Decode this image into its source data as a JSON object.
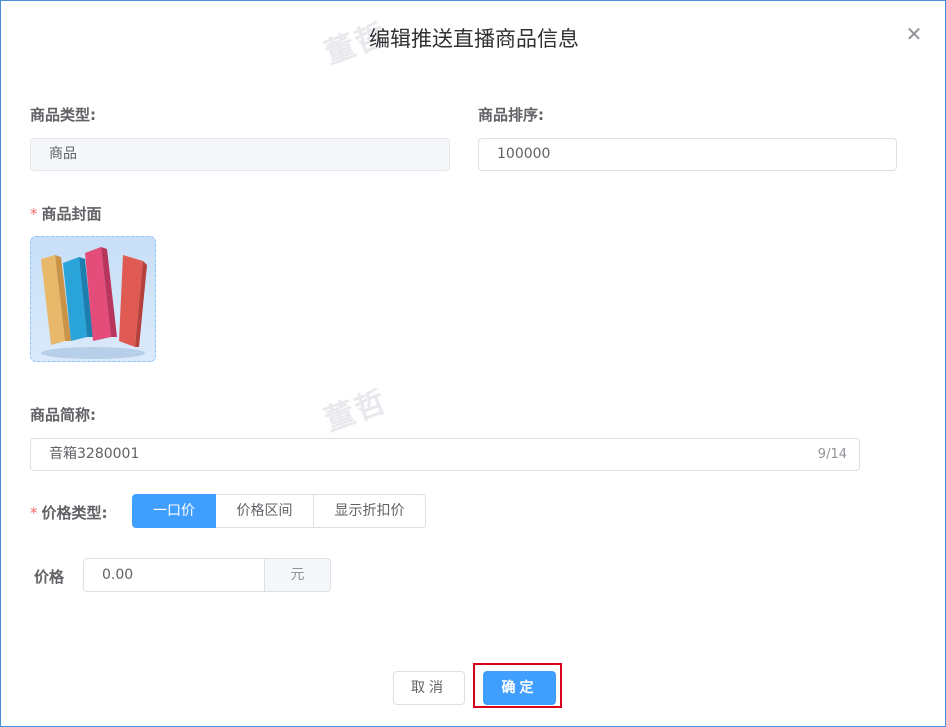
{
  "dialog": {
    "title": "编辑推送直播商品信息",
    "close_icon": "close-icon",
    "watermark_text": "董哲"
  },
  "form": {
    "type_label": "商品类型:",
    "type_value": "商品",
    "sort_label": "商品排序:",
    "sort_value": "100000",
    "cover_required": "*",
    "cover_label": "商品封面",
    "short_name_label": "商品简称:",
    "short_name_value": "音箱3280001",
    "short_name_counter": "9/14",
    "price_type_required": "*",
    "price_type_label": "价格类型:",
    "price_type_options": [
      "一口价",
      "价格区间",
      "显示折扣价"
    ],
    "price_type_selected": "一口价",
    "price_label": "价格",
    "price_value": "0.00",
    "price_unit": "元"
  },
  "footer": {
    "cancel_label": "取消",
    "confirm_label": "确定"
  },
  "colors": {
    "primary": "#409eff",
    "required": "#f56c6c",
    "highlight": "#d9001b"
  }
}
